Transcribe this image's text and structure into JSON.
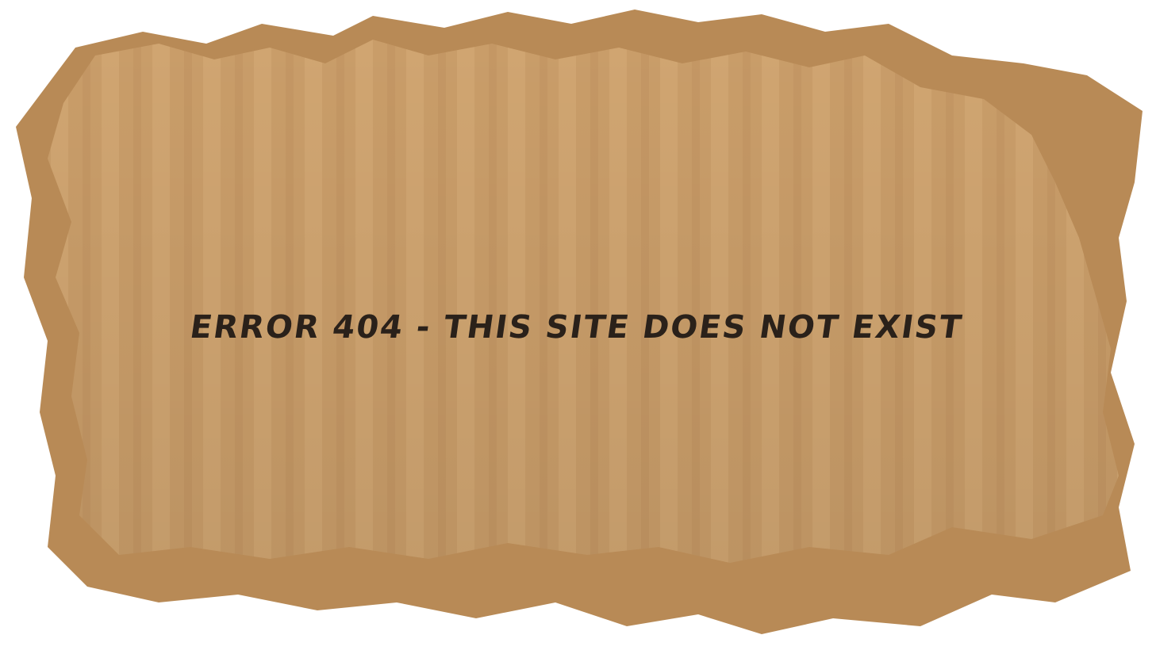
{
  "error_page": {
    "message": "ERROR 404 - THIS SITE DOES NOT EXIST"
  },
  "colors": {
    "background": "#ffffff",
    "cardboard": "#c9a06c",
    "cardboard_shadow": "#a97d4a",
    "text": "#2a211a"
  }
}
